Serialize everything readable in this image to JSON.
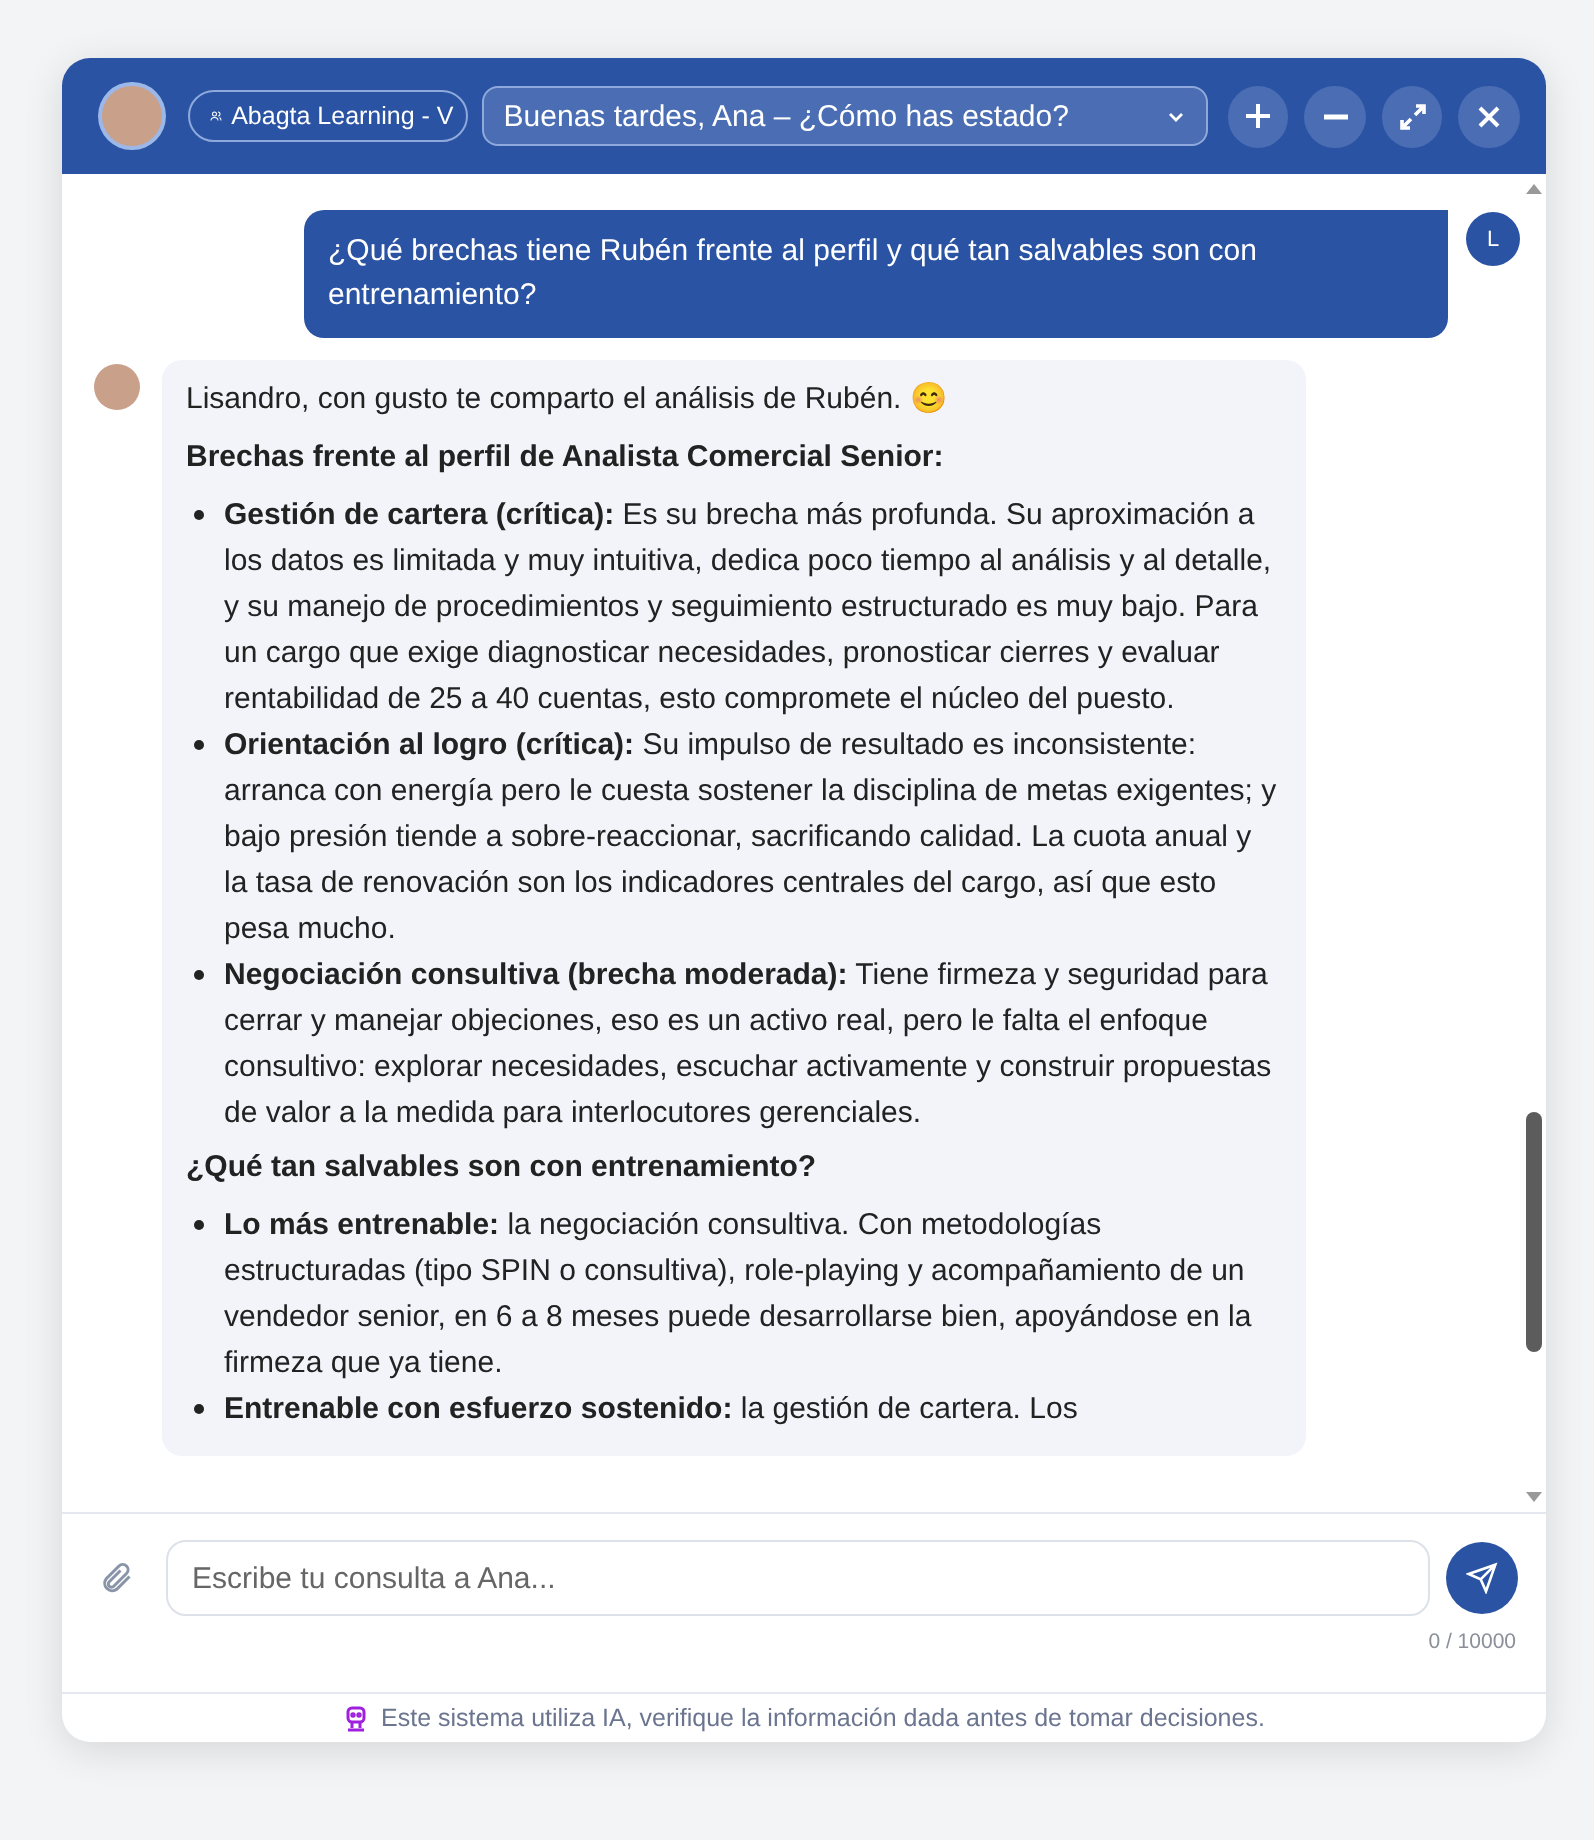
{
  "header": {
    "org_label": "Abagta Learning - V",
    "greeting": "Buenas tardes, Ana – ¿Cómo has estado?",
    "actions": [
      {
        "kind": "add"
      },
      {
        "kind": "minimize"
      },
      {
        "kind": "expand"
      },
      {
        "kind": "close"
      }
    ]
  },
  "messages": [
    {
      "kind": "user",
      "initial": "L",
      "text": "¿Qué brechas tiene Rubén frente al perfil y qué tan salvables son con entrenamiento?"
    },
    {
      "kind": "assistant",
      "blocks": [
        {
          "kind": "paragraph",
          "text": "Lisandro, con gusto te comparto el análisis de Rubén. 😊"
        },
        {
          "kind": "heading",
          "text": "Brechas frente al perfil de Analista Comercial Senior:"
        },
        {
          "kind": "bullets",
          "items": [
            "**Gestión de cartera (crítica):** Es su brecha más profunda. Su aproximación a los datos es limitada y muy intuitiva, dedica poco tiempo al análisis y al detalle, y su manejo de procedimientos y seguimiento estructurado es muy bajo. Para un cargo que exige diagnosticar necesidades, pronosticar cierres y evaluar rentabilidad de 25 a 40 cuentas, esto compromete el núcleo del puesto.",
            "**Orientación al logro (crítica):** Su impulso de resultado es inconsistente: arranca con energía pero le cuesta sostener la disciplina de metas exigentes; y bajo presión tiende a sobre-reaccionar, sacrificando calidad. La cuota anual y la tasa de renovación son los indicadores centrales del cargo, así que esto pesa mucho.",
            "**Negociación consultiva (brecha moderada):** Tiene firmeza y seguridad para cerrar y manejar objeciones, eso es un activo real, pero le falta el enfoque consultivo: explorar necesidades, escuchar activamente y construir propuestas de valor a la medida para interlocutores gerenciales."
          ]
        },
        {
          "kind": "heading",
          "text": "¿Qué tan salvables son con entrenamiento?"
        },
        {
          "kind": "bullets",
          "items": [
            "**Lo más entrenable:** la negociación consultiva. Con metodologías estructuradas (tipo SPIN o consultiva), role-playing y acompañamiento de un vendedor senior, en 6 a 8 meses puede desarrollarse bien, apoyándose en la firmeza que ya tiene.",
            "**Entrenable con esfuerzo sostenido:** la gestión de cartera. Los"
          ]
        }
      ]
    }
  ],
  "composer": {
    "placeholder": "Escribe tu consulta a Ana...",
    "counter": "0 / 10000"
  },
  "footer": "Este sistema utiliza IA, verifique la información dada antes de tomar decisiones."
}
